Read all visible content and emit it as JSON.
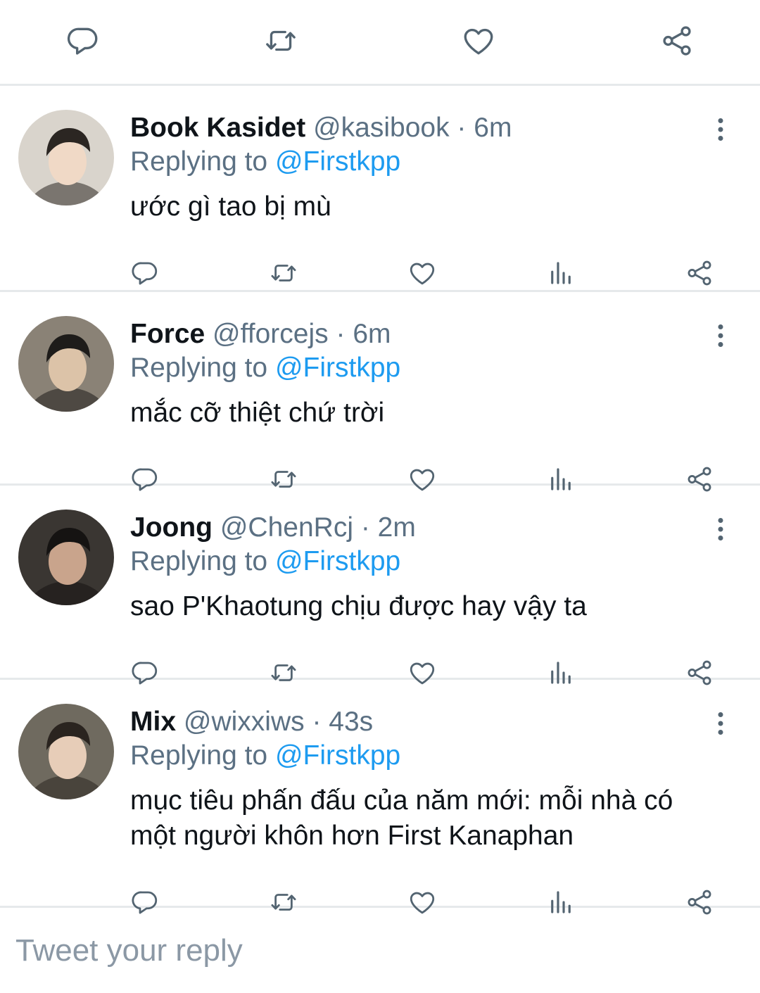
{
  "top_actions": [
    {
      "name": "reply-icon"
    },
    {
      "name": "retweet-icon"
    },
    {
      "name": "like-icon"
    },
    {
      "name": "share-icon"
    }
  ],
  "replies": [
    {
      "display_name": "Book Kasidet",
      "handle": "@kasibook",
      "separator": "·",
      "time": "6m",
      "replying_prefix": "Replying to",
      "replying_to": "@Firstkpp",
      "text": "ước gì tao bị mù",
      "avatar_colors": [
        "#d9d4cc",
        "#2b2622",
        "#f0d9c6"
      ]
    },
    {
      "display_name": "Force",
      "handle": "@fforcejs",
      "separator": "·",
      "time": "6m",
      "replying_prefix": "Replying to",
      "replying_to": "@Firstkpp",
      "text": "mắc cỡ thiệt chứ trời",
      "avatar_colors": [
        "#8a8276",
        "#1e1c1a",
        "#dcc3a8"
      ]
    },
    {
      "display_name": "Joong",
      "handle": "@ChenRcj",
      "separator": "·",
      "time": "2m",
      "replying_prefix": "Replying to",
      "replying_to": "@Firstkpp",
      "text": "sao P'Khaotung chịu được hay vậy ta",
      "avatar_colors": [
        "#3a3632",
        "#151312",
        "#c9a48c"
      ]
    },
    {
      "display_name": "Mix",
      "handle": "@wixxiws",
      "separator": "·",
      "time": "43s",
      "replying_prefix": "Replying to",
      "replying_to": "@Firstkpp",
      "text": "mục tiêu phấn đấu của năm mới: mỗi nhà có một người khôn hơn First Kanaphan",
      "avatar_colors": [
        "#6f6a5f",
        "#2a241f",
        "#e7cdb8"
      ]
    }
  ],
  "composer": {
    "placeholder": "Tweet your reply"
  },
  "colors": {
    "link": "#1d9bf0",
    "secondary_text": "#5b7083",
    "icon": "#536471",
    "divider": "#e6e9eb"
  }
}
